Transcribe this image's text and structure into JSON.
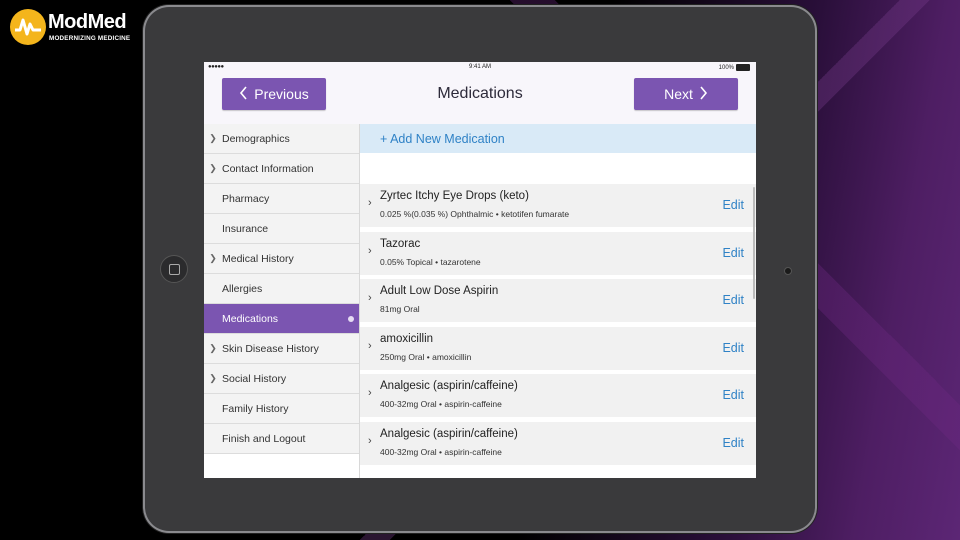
{
  "brand": {
    "name": "ModMed",
    "tagline": "MODERNIZING MEDICINE",
    "accent_color": "#7b55b1",
    "logo_color": "#f4b51c"
  },
  "status_bar": {
    "signal": "●●●●● ",
    "time": "9:41 AM",
    "battery": "100%"
  },
  "nav": {
    "previous_label": "Previous",
    "next_label": "Next",
    "title": "Medications"
  },
  "sidebar": {
    "items": [
      {
        "label": "Demographics",
        "chevron": true
      },
      {
        "label": "Contact Information",
        "chevron": true
      },
      {
        "label": "Pharmacy",
        "chevron": false
      },
      {
        "label": "Insurance",
        "chevron": false
      },
      {
        "label": "Medical History",
        "chevron": true
      },
      {
        "label": "Allergies",
        "chevron": false
      },
      {
        "label": "Medications",
        "chevron": false,
        "active": true
      },
      {
        "label": "Skin Disease History",
        "chevron": true
      },
      {
        "label": "Social History",
        "chevron": true
      },
      {
        "label": "Family History",
        "chevron": false
      },
      {
        "label": "Finish and Logout",
        "chevron": false
      }
    ]
  },
  "main": {
    "add_label": "+ Add New Medication",
    "edit_label": "Edit",
    "medications": [
      {
        "name": "Zyrtec Itchy Eye Drops (keto)",
        "detail": "0.025 %(0.035 %) Ophthalmic • ketotifen fumarate"
      },
      {
        "name": "Tazorac",
        "detail": "0.05% Topical • tazarotene"
      },
      {
        "name": "Adult Low Dose Aspirin",
        "detail": "81mg Oral"
      },
      {
        "name": "amoxicillin",
        "detail": "250mg Oral • amoxicillin"
      },
      {
        "name": "Analgesic (aspirin/caffeine)",
        "detail": "400-32mg Oral • aspirin-caffeine"
      },
      {
        "name": "Analgesic (aspirin/caffeine)",
        "detail": "400-32mg Oral • aspirin-caffeine"
      }
    ]
  }
}
